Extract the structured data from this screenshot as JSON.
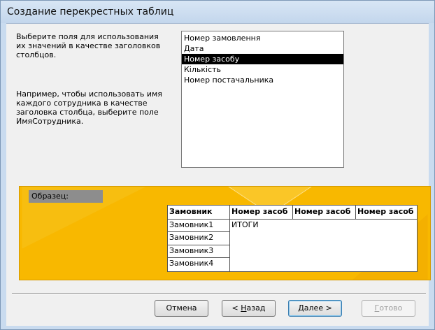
{
  "window": {
    "title": "Создание перекрестных таблиц"
  },
  "instructions": {
    "choose_fields": "Выберите поля для использования\nих значений в качестве заголовков\nстолбцов.",
    "example_text": "Например, чтобы использовать имя\nкаждого сотрудника в качестве\nзаголовка столбца, выберите поле\nИмяСотрудника."
  },
  "fields_list": {
    "items": [
      "Номер замовлення",
      "Дата",
      "Номер засобу",
      "Кількість",
      "Номер постачальника"
    ],
    "selected": "Номер засобу"
  },
  "sample": {
    "label": "Образец:",
    "row_header": "Замовник",
    "column_headers": [
      "Номер засоб",
      "Номер засоб",
      "Номер засоб"
    ],
    "rows": [
      "Замовник1",
      "Замовник2",
      "Замовник3",
      "Замовник4"
    ],
    "value_text": "ИТОГИ"
  },
  "buttons": {
    "cancel": "Отмена",
    "back_prefix": "< ",
    "back_underline": "Н",
    "back_rest": "азад",
    "next_underline": "Д",
    "next_rest": "алее >",
    "finish_underline": "Г",
    "finish_rest": "отово"
  },
  "colors": {
    "sample_background": "#f8b800",
    "selection": "#000000",
    "title_bar": "#c9dbef"
  }
}
